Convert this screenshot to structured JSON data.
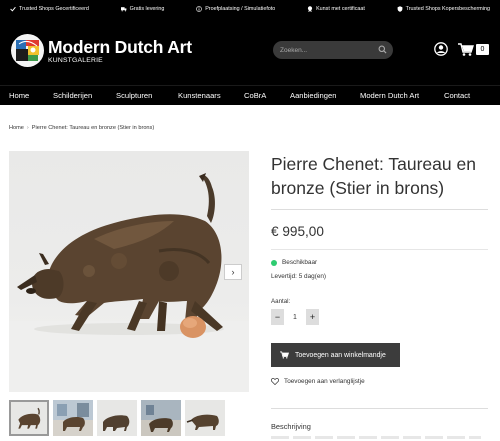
{
  "trustbar": {
    "items": [
      {
        "label": "Trusted Shops Gecertificeerd",
        "icon": "check-icon"
      },
      {
        "label": "Gratis levering",
        "icon": "truck-icon"
      },
      {
        "label": "Proefplaatsing / Simulatiefoto",
        "icon": "info-icon"
      },
      {
        "label": "Kunst met certificaat",
        "icon": "certificate-icon"
      },
      {
        "label": "Trusted Shops Kopersbescherming",
        "icon": "shield-icon"
      }
    ]
  },
  "header": {
    "brand_name": "Modern Dutch Art",
    "brand_sub": "KUNSTGALERIE",
    "search_placeholder": "Zoeken...",
    "cart_count": "0"
  },
  "nav": {
    "items": [
      "Home",
      "Schilderijen",
      "Sculpturen",
      "Kunstenaars",
      "CoBrA",
      "Aanbiedingen",
      "Modern Dutch Art",
      "Contact"
    ]
  },
  "breadcrumb": {
    "home": "Home",
    "separator": "›",
    "current": "Pierre Chenet: Taureau en bronze (Stier in brons)"
  },
  "product": {
    "title": "Pierre Chenet: Taureau en bronze (Stier in brons)",
    "price": "€ 995,00",
    "availability": "Beschikbaar",
    "delivery": "Levertijd: 5 dag(en)",
    "qty_label": "Aantal:",
    "qty_value": "1",
    "minus": "−",
    "plus": "+",
    "add_to_cart": "Toevoegen aan winkelmandje",
    "wishlist": "Toevoegen aan verlanglijstje",
    "description_title": "Beschrijving",
    "next_arrow": "›"
  },
  "colors": {
    "header_bg": "#000000",
    "available_dot": "#2ecc71",
    "button_bg": "#3c3c3c"
  }
}
